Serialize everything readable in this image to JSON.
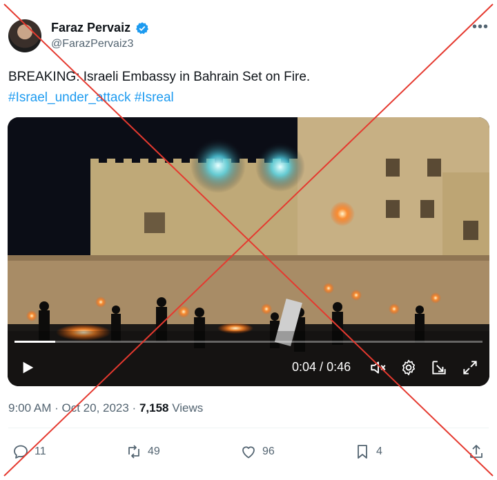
{
  "author": {
    "name": "Faraz Pervaiz",
    "handle": "@FarazPervaiz3",
    "verified_icon": "verified-badge-icon"
  },
  "tweet": {
    "text": "BREAKING: Israeli Embassy in Bahrain Set on Fire.",
    "hashtags": [
      "#Israel_under_attack",
      "#Isreal"
    ]
  },
  "video": {
    "current_time": "0:04",
    "separator": " / ",
    "duration": "0:46",
    "progress_fraction": 0.087
  },
  "meta": {
    "time": "9:00 AM",
    "dot": " · ",
    "date": "Oct 20, 2023",
    "views_count": "7,158",
    "views_label": " Views"
  },
  "actions": {
    "replies": "11",
    "reposts": "49",
    "likes": "96",
    "bookmarks": "4"
  },
  "colors": {
    "accent": "#1d9bf0",
    "cross": "#e5392f"
  }
}
